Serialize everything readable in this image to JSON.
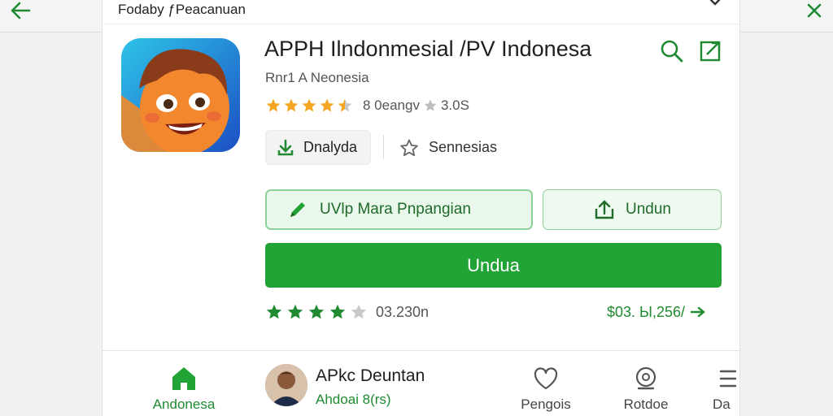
{
  "header": {
    "title": "Fodaby ƒPeacanuan"
  },
  "app": {
    "title": "APPH Ilndonmesial /PV Indonesa",
    "developer": "Rnr1 A Neonesia",
    "rating_text": "8 0eangv",
    "rating_secondary": "3.0S",
    "rating_stars": 4.5
  },
  "actions": {
    "download_chip": "Dnalyda",
    "favorite_chip": "Sennesias",
    "edit_button": "UVlp Mara Pnpangian",
    "undun_button": "Undun",
    "primary_button": "Undua"
  },
  "summary": {
    "rating_stars": 4,
    "rating_count": "03.230n",
    "price_text": "$03. Ы,256/"
  },
  "bottom_nav": {
    "home_label": "Andonesa",
    "featured_name": "APkc Deuntan",
    "featured_sub": "Ahdoai 8(rs)",
    "item2_label": "Pengois",
    "item3_label": "Rotdoe",
    "item4_label": "Da"
  },
  "colors": {
    "accent_green": "#22a336",
    "light_green_fill": "#eaf8ec",
    "star_orange": "#f5a623",
    "star_green": "#1f8a31"
  },
  "icons": [
    "back-arrow-icon",
    "close-icon",
    "chevron-down-icon",
    "search-icon",
    "share-icon",
    "download-icon",
    "star-outline-icon",
    "pencil-icon",
    "upload-icon",
    "arrow-right-icon",
    "home-icon",
    "heart-icon",
    "chat-icon",
    "menu-icon"
  ]
}
